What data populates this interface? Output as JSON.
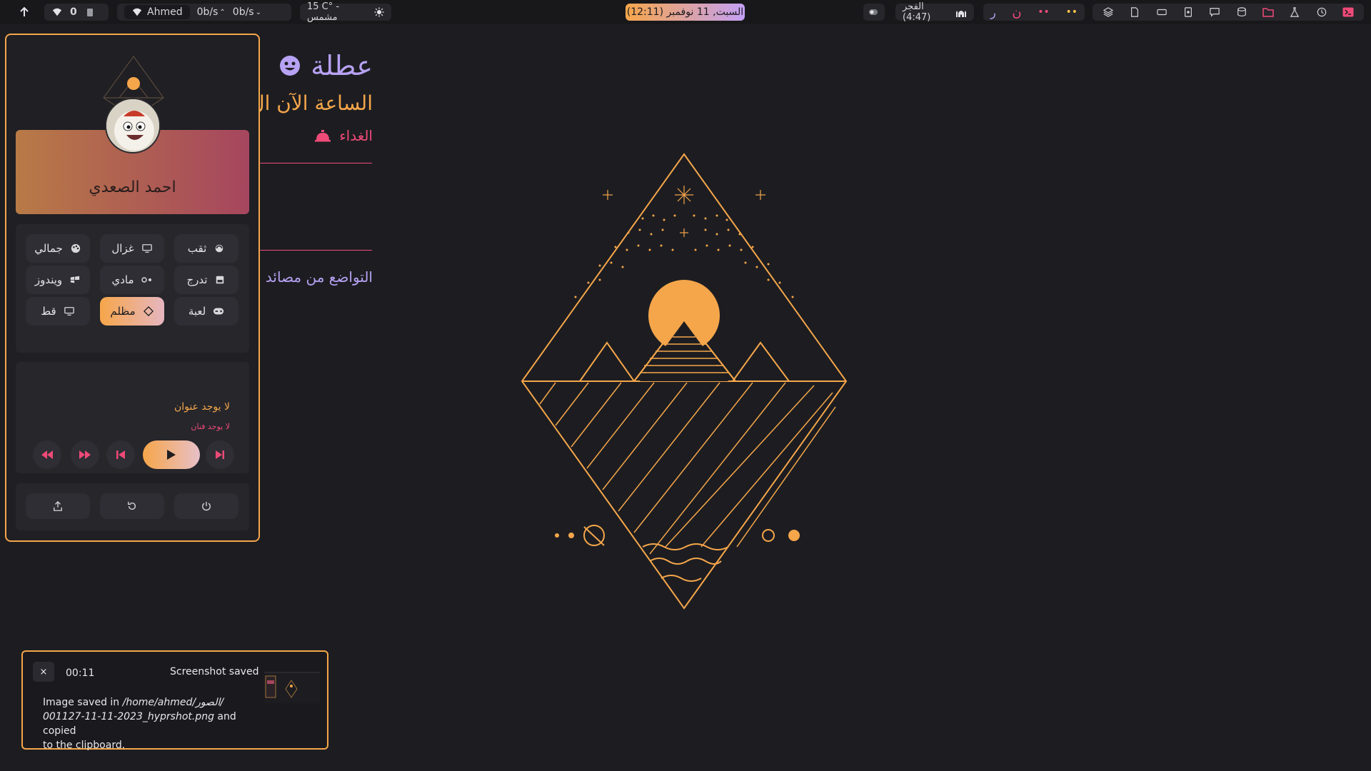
{
  "topbar": {
    "user": "Ahmed",
    "net_up": "0b/s",
    "net_down": "0b/s",
    "weather": "15 C° - مشمس",
    "datetime": "(12:11) السبت, 11 نوفمبر",
    "prayer": "الفجر (4:47)",
    "indicator_number": "0"
  },
  "panel": {
    "profile_name": "احمد الصعدي",
    "theme_buttons": [
      {
        "label": "ثقب",
        "icon": "blackhole-icon"
      },
      {
        "label": "غزال",
        "icon": "monitor-icon"
      },
      {
        "label": "جمالي",
        "icon": "palette-icon"
      },
      {
        "label": "تدرج",
        "icon": "gradient-icon"
      },
      {
        "label": "مادي",
        "icon": "toggle-icon"
      },
      {
        "label": "ويندوز",
        "icon": "windows-icon"
      },
      {
        "label": "لعبة",
        "icon": "gamepad-icon"
      },
      {
        "label": "مظلم",
        "icon": "diamond-icon",
        "active": true
      },
      {
        "label": "قط",
        "icon": "monitor-icon"
      }
    ],
    "media": {
      "title": "لا يوجد عنوان",
      "artist": "لا يوجد فنان"
    }
  },
  "desktop": {
    "holiday": "عطلة",
    "clock_line": "الساعة الآن ال",
    "meal": "الغداء",
    "quote": "التواضع من مصائد"
  },
  "notification": {
    "time": "00:11",
    "title": "Screenshot saved",
    "body_prefix": "Image saved in ",
    "body_path": "/home/ahmed/الصور/",
    "body_file": "001127-11-11-2023_hyprshot.png",
    "body_suffix": " and copied",
    "body_end": "to the clipboard.",
    "close_label": "×"
  },
  "colors": {
    "accent_orange": "#f5a64a",
    "accent_pink": "#ef4a78",
    "accent_purple": "#b7a2f4",
    "background": "#1d1d21"
  }
}
